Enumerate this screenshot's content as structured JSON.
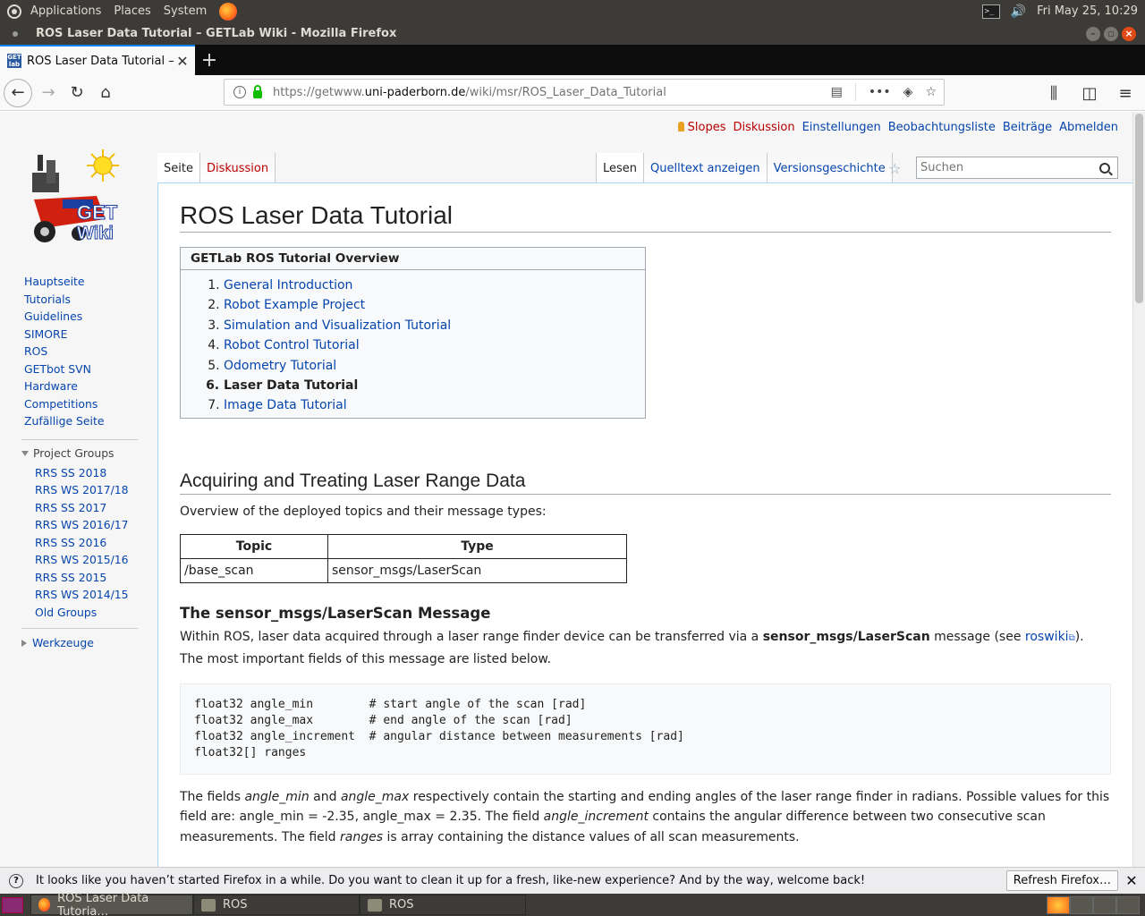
{
  "panel": {
    "applications": "Applications",
    "places": "Places",
    "system": "System",
    "clock": "Fri May 25, 10:29"
  },
  "window": {
    "title": "ROS Laser Data Tutorial – GETLab Wiki - Mozilla Firefox"
  },
  "browser": {
    "tab_title": "ROS Laser Data Tutorial – GETLab Wiki",
    "url_prefix": "https://getwww.",
    "url_domain": "uni-paderborn.de",
    "url_path": "/wiki/msr/ROS_Laser_Data_Tutorial"
  },
  "personal": {
    "user": "Slopes",
    "talk": "Diskussion",
    "preferences": "Einstellungen",
    "watchlist": "Beobachtungsliste",
    "contributions": "Beiträge",
    "logout": "Abmelden"
  },
  "tabs": {
    "page": "Seite",
    "discussion": "Diskussion",
    "read": "Lesen",
    "view_source": "Quelltext anzeigen",
    "history": "Versionsgeschichte"
  },
  "search": {
    "placeholder": "Suchen"
  },
  "sidebar": {
    "nav": [
      "Hauptseite",
      "Tutorials",
      "Guidelines",
      "SIMORE",
      "ROS",
      "GETbot SVN",
      "Hardware",
      "Competitions",
      "Zufällige Seite"
    ],
    "project_groups_heading": "Project Groups",
    "project_groups": [
      "RRS SS 2018",
      "RRS WS 2017/18",
      "RRS SS 2017",
      "RRS WS 2016/17",
      "RRS SS 2016",
      "RRS WS 2015/16",
      "RRS SS 2015",
      "RRS WS 2014/15",
      "Old Groups"
    ],
    "tools_heading": "Werkzeuge"
  },
  "article": {
    "title": "ROS Laser Data Tutorial",
    "overview_heading": "GETLab ROS Tutorial Overview",
    "overview_items": [
      "General Introduction",
      "Robot Example Project",
      "Simulation and Visualization Tutorial",
      "Robot Control Tutorial",
      "Odometry Tutorial",
      "Laser Data Tutorial",
      "Image Data Tutorial"
    ],
    "section_heading": "Acquiring and Treating Laser Range Data",
    "section_intro": "Overview of the deployed topics and their message types:",
    "table": {
      "headers": [
        "Topic",
        "Type"
      ],
      "rows": [
        [
          "/base_scan",
          "sensor_msgs/LaserScan"
        ]
      ]
    },
    "subsection_heading": "The sensor_msgs/LaserScan Message",
    "para1_a": "Within ROS, laser data acquired through a laser range finder device can be transferred via a ",
    "para1_bold": "sensor_msgs/LaserScan",
    "para1_b": " message (see ",
    "para1_link": "roswiki",
    "para1_c": "). The most important fields of this message are listed below.",
    "code": "float32 angle_min        # start angle of the scan [rad]\nfloat32 angle_max        # end angle of the scan [rad]\nfloat32 angle_increment  # angular distance between measurements [rad]\nfloat32[] ranges",
    "para2_a": "The fields ",
    "para2_i1": "angle_min",
    "para2_b": " and ",
    "para2_i2": "angle_max",
    "para2_c": " respectively contain the starting and ending angles of the laser range finder in radians. Possible values for this field are: angle_min = -2.35, angle_max = 2.35. The field ",
    "para2_i3": "angle_increment",
    "para2_d": " contains the angular difference between two consecutive scan measurements. The field ",
    "para2_i4": "ranges",
    "para2_e": " is array containing the distance values of all scan measurements."
  },
  "notification": {
    "text": "It looks like you haven’t started Firefox in a while. Do you want to clean it up for a fresh, like-new experience? And by the way, welcome back!",
    "button": "Refresh Firefox…"
  },
  "taskbar": {
    "tasks": [
      "ROS Laser Data Tutoria…",
      "ROS",
      "ROS"
    ]
  },
  "logo_text": {
    "line1": "GET",
    "line2": "Wiki"
  }
}
